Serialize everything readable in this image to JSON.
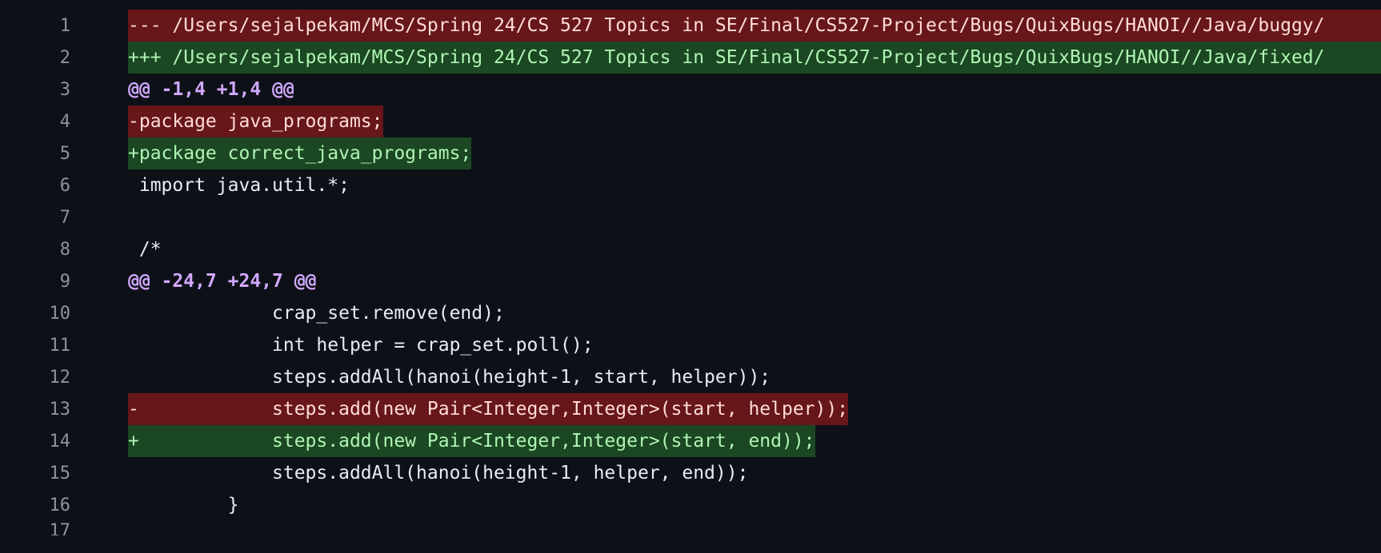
{
  "diff": {
    "lines": [
      {
        "number": "1",
        "type": "del-header",
        "text": "--- /Users/sejalpekam/MCS/Spring 24/CS 527 Topics in SE/Final/CS527-Project/Bugs/QuixBugs/HANOI//Java/buggy/"
      },
      {
        "number": "2",
        "type": "add-header",
        "text": "+++ /Users/sejalpekam/MCS/Spring 24/CS 527 Topics in SE/Final/CS527-Project/Bugs/QuixBugs/HANOI//Java/fixed/"
      },
      {
        "number": "3",
        "type": "hunk",
        "text": "@@ -1,4 +1,4 @@"
      },
      {
        "number": "4",
        "type": "del",
        "text": "-package java_programs;"
      },
      {
        "number": "5",
        "type": "add",
        "text": "+package correct_java_programs;"
      },
      {
        "number": "6",
        "type": "context",
        "text": " import java.util.*;"
      },
      {
        "number": "7",
        "type": "context",
        "text": ""
      },
      {
        "number": "8",
        "type": "context",
        "text": " /*"
      },
      {
        "number": "9",
        "type": "hunk",
        "text": "@@ -24,7 +24,7 @@"
      },
      {
        "number": "10",
        "type": "context",
        "text": "             crap_set.remove(end);"
      },
      {
        "number": "11",
        "type": "context",
        "text": "             int helper = crap_set.poll();"
      },
      {
        "number": "12",
        "type": "context",
        "text": "             steps.addAll(hanoi(height-1, start, helper));"
      },
      {
        "number": "13",
        "type": "del",
        "text": "-            steps.add(new Pair<Integer,Integer>(start, helper));"
      },
      {
        "number": "14",
        "type": "add",
        "text": "+            steps.add(new Pair<Integer,Integer>(start, end));"
      },
      {
        "number": "15",
        "type": "context",
        "text": "             steps.addAll(hanoi(height-1, helper, end));"
      },
      {
        "number": "16",
        "type": "context",
        "text": "         }"
      },
      {
        "number": "17",
        "type": "context",
        "text": ""
      }
    ]
  },
  "colors": {
    "background": "#0d1117",
    "line_number": "#8b949e",
    "deletion_bg": "#67161a",
    "addition_bg": "#1b4722",
    "hunk_text": "#d2a8ff"
  }
}
